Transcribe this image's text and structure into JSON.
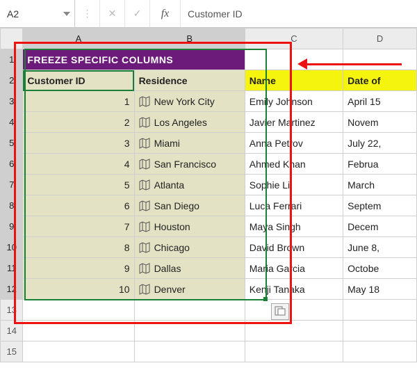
{
  "formula_bar": {
    "name_box": "A2",
    "cancel_glyph": "✕",
    "confirm_glyph": "✓",
    "fx_label": "fx",
    "value": "Customer ID"
  },
  "columns": [
    "A",
    "B",
    "C",
    "D"
  ],
  "annotation": {
    "arrow_dir": "left"
  },
  "sheet": {
    "title": "FREEZE SPECIFIC COLUMNS",
    "headers": {
      "A": "Customer ID",
      "B": "Residence",
      "C": "Name",
      "D": "Date of"
    },
    "rows": [
      {
        "id": "1",
        "city": "New York City",
        "name": "Emily Johnson",
        "date": "April 15"
      },
      {
        "id": "2",
        "city": "Los Angeles",
        "name": "Javier Martinez",
        "date": "Novem"
      },
      {
        "id": "3",
        "city": "Miami",
        "name": "Anna Petrov",
        "date": "July 22,"
      },
      {
        "id": "4",
        "city": "San Francisco",
        "name": "Ahmed Khan",
        "date": "Februa"
      },
      {
        "id": "5",
        "city": "Atlanta",
        "name": "Sophie Li",
        "date": "March"
      },
      {
        "id": "6",
        "city": "San Diego",
        "name": "Luca Ferrari",
        "date": "Septem"
      },
      {
        "id": "7",
        "city": "Houston",
        "name": "Maya Singh",
        "date": "Decem"
      },
      {
        "id": "8",
        "city": "Chicago",
        "name": "David Brown",
        "date": "June 8,"
      },
      {
        "id": "9",
        "city": "Dallas",
        "name": "Maria Garcia",
        "date": "Octobe"
      },
      {
        "id": "10",
        "city": "Denver",
        "name": "Kenji Tanaka",
        "date": "May 18"
      }
    ],
    "trailing_rows": [
      "13",
      "14",
      "15"
    ]
  }
}
